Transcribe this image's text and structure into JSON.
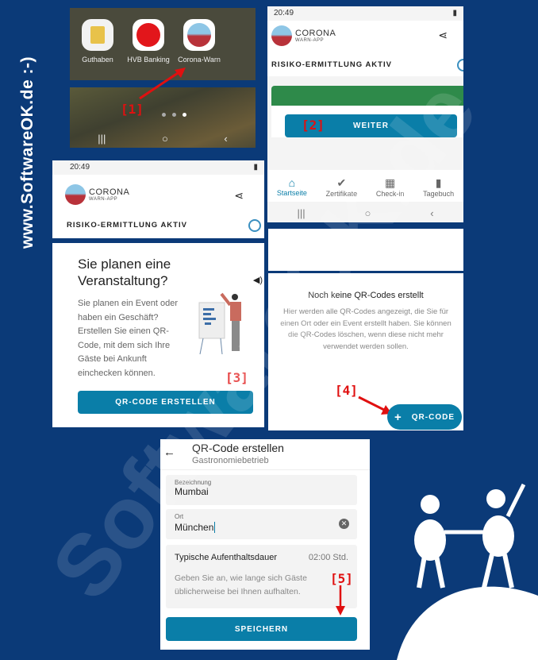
{
  "side_text": "www.SoftwareOK.de :-)",
  "watermark": "SoftwareOK.de",
  "accent": "#0a7ea8",
  "markers": [
    "[1]",
    "[2]",
    "[3]",
    "[4]",
    "[5]"
  ],
  "home": {
    "apps": [
      {
        "label": "Guthaben",
        "icon": "sim-settings-icon"
      },
      {
        "label": "HVB Banking",
        "icon": "hvb-logo-icon"
      },
      {
        "label": "Corona-Warn",
        "icon": "corona-warn-icon"
      }
    ]
  },
  "status": {
    "time": "20:49"
  },
  "cwa": {
    "logo_title": "CORONA",
    "logo_sub": "WARN-APP",
    "risk": "RISIKO-ERMITTLUNG AKTIV",
    "weiter": "WEITER",
    "nav": [
      "Startseite",
      "Zertifikate",
      "Check-in",
      "Tagebuch"
    ]
  },
  "event": {
    "title": "Sie planen eine Veranstaltung?",
    "body": "Sie planen ein Event oder haben ein Geschäft? Erstellen Sie einen QR-Code, mit dem sich Ihre Gäste bei Ankunft einchecken können.",
    "button": "QR-CODE ERSTELLEN"
  },
  "qrlist": {
    "title": "Noch keine QR-Codes erstellt",
    "body": "Hier werden alle QR-Codes angezeigt, die Sie für einen Ort oder ein Event erstellt haben. Sie können die QR-Codes löschen, wenn diese nicht mehr verwendet werden sollen.",
    "fab": "QR-CODE"
  },
  "form": {
    "title": "QR-Code erstellen",
    "subtitle": "Gastronomiebetrieb",
    "name_label": "Bezeichnung",
    "name_value": "Mumbai",
    "place_label": "Ort",
    "place_value": "München",
    "duration_label": "Typische Aufenthaltsdauer",
    "duration_value": "02:00 Std.",
    "duration_hint": "Geben Sie an, wie lange sich Gäste üblicherweise bei Ihnen aufhalten.",
    "save": "SPEICHERN"
  }
}
